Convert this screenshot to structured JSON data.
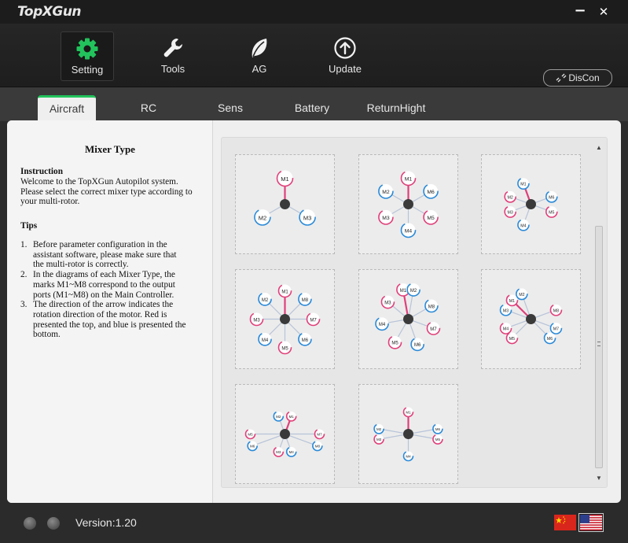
{
  "app": {
    "logo_text": "TopXGun",
    "minimize_glyph": "−",
    "close_glyph": "✕"
  },
  "toolbar": {
    "items": [
      {
        "label": "Setting",
        "icon": "gear-icon",
        "active": true
      },
      {
        "label": "Tools",
        "icon": "wrench-icon",
        "active": false
      },
      {
        "label": "AG",
        "icon": "leaf-icon",
        "active": false
      },
      {
        "label": "Update",
        "icon": "upload-icon",
        "active": false
      }
    ],
    "disconnect_label": "DisCon"
  },
  "tabs": [
    {
      "label": "Aircraft",
      "active": true
    },
    {
      "label": "RC",
      "active": false
    },
    {
      "label": "Sens",
      "active": false
    },
    {
      "label": "Battery",
      "active": false
    },
    {
      "label": "ReturnHight",
      "active": false
    }
  ],
  "info": {
    "title": "Mixer Type",
    "instruction_heading": "Instruction",
    "instruction_text": "Welcome to the TopXGun Autopilot system. Please select the correct mixer type according to your multi-rotor.",
    "tips_heading": "Tips",
    "tips": [
      {
        "num": "1.",
        "text": "Before parameter configuration in the assistant software, please make sure that the multi-rotor is correctly."
      },
      {
        "num": "2.",
        "text": "In the diagrams of each Mixer Type, the marks M1~M8 correspond to the output ports (M1~M8) on the Main Controller."
      },
      {
        "num": "3.",
        "text": "The direction of the arrow indicates the rotation direction of the motor. Red is presented the top, and blue is presented the bottom."
      }
    ]
  },
  "mixers": [
    {
      "type": "tri",
      "motors": [
        "M1",
        "M2",
        "M3"
      ]
    },
    {
      "type": "hexa",
      "motors": [
        "M1",
        "M2",
        "M3",
        "M4",
        "M5",
        "M6"
      ]
    },
    {
      "type": "hexa-y",
      "motors": [
        "M1",
        "M2",
        "M3",
        "M4",
        "M5",
        "M6"
      ]
    },
    {
      "type": "octo",
      "motors": [
        "M1",
        "M2",
        "M3",
        "M4",
        "M5",
        "M6",
        "M7",
        "M8"
      ]
    },
    {
      "type": "octo-v",
      "motors": [
        "M1",
        "M2",
        "M3",
        "M4",
        "M5",
        "M6",
        "M7",
        "M8"
      ]
    },
    {
      "type": "octo-x",
      "motors": [
        "M1",
        "M2",
        "M3",
        "M4",
        "M5",
        "M6",
        "M7",
        "M8"
      ]
    },
    {
      "type": "octo-coax-h",
      "motors": [
        "M1",
        "M2",
        "M3",
        "M4",
        "M5",
        "M6",
        "M7",
        "M8"
      ]
    },
    {
      "type": "hexa-coax",
      "motors": [
        "M1",
        "M2",
        "M3",
        "M4",
        "M5",
        "M6"
      ]
    }
  ],
  "colors": {
    "accent_green": "#22c35c",
    "motor_red": "#e0407a",
    "motor_blue": "#2a8ad8",
    "hub": "#3a3a3a"
  },
  "footer": {
    "version": "Version:1.20",
    "flags": [
      "china-flag-icon",
      "usa-flag-icon"
    ]
  }
}
